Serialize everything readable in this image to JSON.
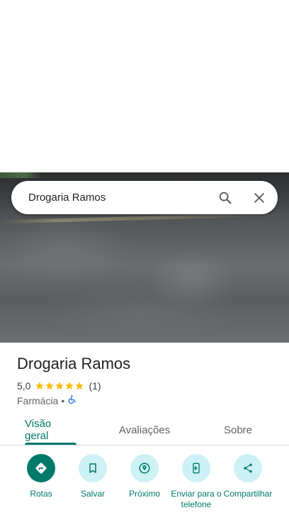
{
  "search": {
    "query": "Drogaria Ramos",
    "icons": {
      "search": "search-icon",
      "clear": "close-icon"
    }
  },
  "place": {
    "name": "Drogaria Ramos",
    "rating": "5,0",
    "stars": 5,
    "review_count": "(1)",
    "category": "Farmácia",
    "separator": "•",
    "accessibility_icon": "wheelchair-icon"
  },
  "tabs": [
    {
      "label": "Visão geral",
      "active": true
    },
    {
      "label": "Avaliações",
      "active": false
    },
    {
      "label": "Sobre",
      "active": false
    }
  ],
  "actions": [
    {
      "label": "Rotas",
      "icon": "directions-icon"
    },
    {
      "label": "Salvar",
      "icon": "bookmark-icon"
    },
    {
      "label": "Próximo",
      "icon": "nearby-icon"
    },
    {
      "label": "Enviar para o telefone",
      "icon": "send-to-phone-icon"
    },
    {
      "label": "Compartilhar",
      "icon": "share-icon"
    }
  ],
  "colors": {
    "accent": "#00796b",
    "action_bg": "#cdf1f5",
    "star": "#fbbc04"
  }
}
